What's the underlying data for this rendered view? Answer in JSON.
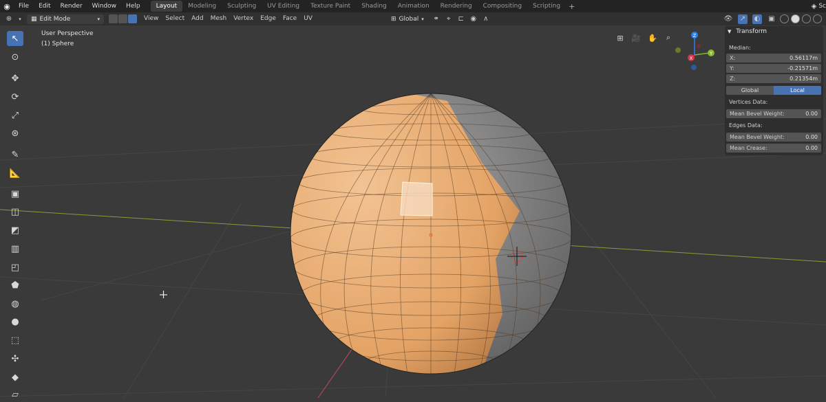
{
  "topbar": {
    "menus": [
      "File",
      "Edit",
      "Render",
      "Window",
      "Help"
    ],
    "tabs": [
      "Layout",
      "Modeling",
      "Sculpting",
      "UV Editing",
      "Texture Paint",
      "Shading",
      "Animation",
      "Rendering",
      "Compositing",
      "Scripting"
    ],
    "active_tab": "Layout",
    "scene_label": "Sc"
  },
  "header": {
    "mode": "Edit Mode",
    "menus": [
      "View",
      "Select",
      "Add",
      "Mesh",
      "Vertex",
      "Edge",
      "Face",
      "UV"
    ],
    "orientation": "Global"
  },
  "viewport": {
    "perspective_label": "User Perspective",
    "object_label": "(1) Sphere",
    "gizmo_axes": {
      "x": "X",
      "y": "Y",
      "z": "Z"
    },
    "axis_colors": {
      "x": "#d9344a",
      "y": "#86b92b",
      "z": "#2c7fe6"
    }
  },
  "npanel": {
    "title": "Transform",
    "median_label": "Median:",
    "x_label": "X:",
    "x_value": "0.56117m",
    "y_label": "Y:",
    "y_value": "-0.21571m",
    "z_label": "Z:",
    "z_value": "0.21354m",
    "global_label": "Global",
    "local_label": "Local",
    "vertices_label": "Vertices Data:",
    "vertex_bevel_label": "Mean Bevel Weight:",
    "vertex_bevel_value": "0.00",
    "edges_label": "Edges Data:",
    "edge_bevel_label": "Mean Bevel Weight:",
    "edge_bevel_value": "0.00",
    "crease_label": "Mean Crease:",
    "crease_value": "0.00"
  },
  "colors": {
    "accent": "#4772b3",
    "selected_face": "#e8a766",
    "unselected_face": "#8a8a8a"
  },
  "icons": {
    "toolbar": [
      "cursor-select-icon",
      "3d-cursor-icon",
      "move-icon",
      "rotate-icon",
      "scale-icon",
      "transform-icon",
      "annotate-icon",
      "measure-icon",
      "extrude-icon",
      "inset-icon",
      "bevel-icon",
      "loop-cut-icon",
      "knife-icon",
      "poly-build-icon",
      "spin-icon",
      "smooth-icon",
      "shrink-fatten-icon",
      "shear-icon",
      "rip-icon"
    ]
  }
}
